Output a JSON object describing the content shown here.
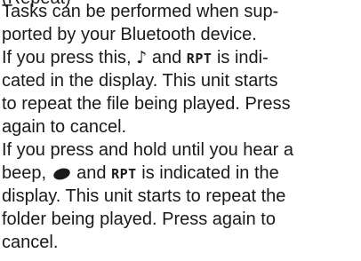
{
  "document": {
    "cutoff_heading": "(Repeat)",
    "lines": {
      "l1": "Tasks can be performed when sup-",
      "l2": "ported by your Bluetooth device.",
      "l3_a": "If you press this, ",
      "l3_icon": "♪",
      "l3_b": " and ",
      "l3_ind": "RPT",
      "l3_c": " is indi-",
      "l4": "cated in the display. This unit starts",
      "l5": "to repeat the file being played. Press",
      "l6": "again to cancel.",
      "l7": "If you press and hold until you hear a",
      "l8_a": "beep, ",
      "l8_b": " and ",
      "l8_ind": "RPT",
      "l8_c": " is indicated in the",
      "l9": "display. This unit starts to repeat the",
      "l10": "folder being played. Press again to",
      "l11": "cancel."
    },
    "icons": {
      "track_repeat": "music-note-icon",
      "folder_repeat": "folder-repeat-icon"
    },
    "text_color": "#1a1a1a"
  }
}
